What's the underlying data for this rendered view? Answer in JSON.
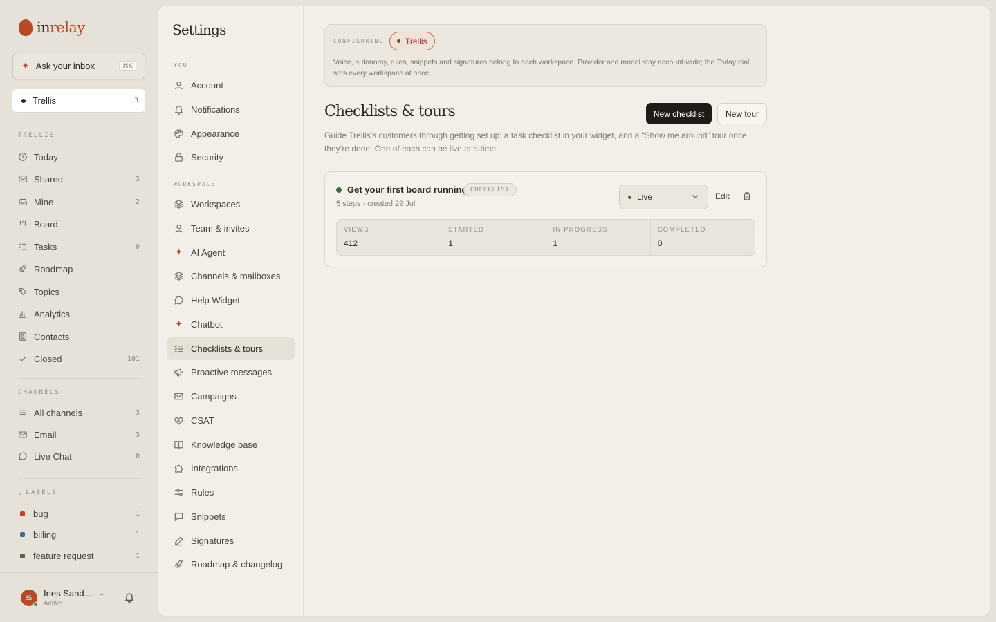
{
  "brand": {
    "name_prefix": "in",
    "name_suffix": "relay"
  },
  "ask": {
    "label": "Ask your inbox",
    "shortcut": "⌘K"
  },
  "workspace": {
    "name": "Trellis",
    "count": "3"
  },
  "sidebar": {
    "section_trellis": "TRELLIS",
    "items": [
      {
        "label": "Today",
        "count": "",
        "icon": "clock-icon"
      },
      {
        "label": "Shared",
        "count": "3",
        "icon": "inbox-icon"
      },
      {
        "label": "Mine",
        "count": "2",
        "icon": "inbox-tray-icon"
      },
      {
        "label": "Board",
        "count": "",
        "icon": "board-icon"
      },
      {
        "label": "Tasks",
        "count": "0",
        "icon": "tasks-icon"
      },
      {
        "label": "Roadmap",
        "count": "",
        "icon": "rocket-icon"
      },
      {
        "label": "Topics",
        "count": "",
        "icon": "tag-icon"
      },
      {
        "label": "Analytics",
        "count": "",
        "icon": "bar-chart-icon"
      },
      {
        "label": "Contacts",
        "count": "",
        "icon": "contact-card-icon"
      },
      {
        "label": "Closed",
        "count": "101",
        "icon": "check-icon"
      }
    ],
    "section_channels": "CHANNELS",
    "channels": [
      {
        "label": "All channels",
        "count": "3",
        "icon": "lines-icon"
      },
      {
        "label": "Email",
        "count": "3",
        "icon": "mail-icon"
      },
      {
        "label": "Live Chat",
        "count": "0",
        "icon": "chat-bubble-icon"
      }
    ],
    "section_labels": "LABELS",
    "labels": [
      {
        "label": "bug",
        "count": "1",
        "color": "#b54a2a"
      },
      {
        "label": "billing",
        "count": "1",
        "color": "#3e6a9a"
      },
      {
        "label": "feature request",
        "count": "1",
        "color": "#4d6b3e"
      }
    ]
  },
  "user": {
    "initials": "IS",
    "name": "Ines Sand...",
    "status": "Active"
  },
  "settings": {
    "title": "Settings",
    "section_you": "YOU",
    "you_items": [
      {
        "label": "Account",
        "icon": "user-icon"
      },
      {
        "label": "Notifications",
        "icon": "bell-icon"
      },
      {
        "label": "Appearance",
        "icon": "palette-icon"
      },
      {
        "label": "Security",
        "icon": "lock-icon"
      }
    ],
    "section_workspace": "WORKSPACE",
    "workspace_items": [
      {
        "label": "Workspaces",
        "icon": "layers-icon"
      },
      {
        "label": "Team & invites",
        "icon": "user-icon"
      },
      {
        "label": "AI Agent",
        "icon": "sparkle-icon"
      },
      {
        "label": "Channels & mailboxes",
        "icon": "layers-icon"
      },
      {
        "label": "Help Widget",
        "icon": "chat-bubble-icon"
      },
      {
        "label": "Chatbot",
        "icon": "sparkle-icon"
      },
      {
        "label": "Checklists & tours",
        "icon": "checklist-icon"
      },
      {
        "label": "Proactive messages",
        "icon": "megaphone-icon"
      },
      {
        "label": "Campaigns",
        "icon": "mail-icon"
      },
      {
        "label": "CSAT",
        "icon": "heart-hand-icon"
      },
      {
        "label": "Knowledge base",
        "icon": "book-icon"
      },
      {
        "label": "Integrations",
        "icon": "puzzle-icon"
      },
      {
        "label": "Rules",
        "icon": "sliders-icon"
      },
      {
        "label": "Snippets",
        "icon": "message-square-icon"
      },
      {
        "label": "Signatures",
        "icon": "pen-icon"
      },
      {
        "label": "Roadmap & changelog",
        "icon": "rocket-icon"
      }
    ],
    "active": "Checklists & tours"
  },
  "config": {
    "label": "CONFIGURING",
    "workspace": "Trellis",
    "description": "Voice, autonomy, rules, snippets and signatures belong to each workspace. Provider and model stay account-wide; the Today dial sets every workspace at once."
  },
  "page": {
    "title": "Checklists & tours",
    "new_checklist": "New checklist",
    "new_tour": "New tour",
    "description": "Guide Trellis’s customers through getting set up: a task checklist in your widget, and a “Show me around” tour once they’re done. One of each can be live at a time."
  },
  "checklist": {
    "title": "Get your first board running",
    "badge": "CHECKLIST",
    "meta": "5 steps · created 29 Jul",
    "status": "Live",
    "edit": "Edit",
    "stats": [
      {
        "label": "VIEWS",
        "value": "412"
      },
      {
        "label": "STARTED",
        "value": "1"
      },
      {
        "label": "IN PROGRESS",
        "value": "1"
      },
      {
        "label": "COMPLETED",
        "value": "0"
      }
    ]
  },
  "colors": {
    "accent": "#b54a2a",
    "live": "#3f6b3a",
    "background": "#e7e2d9",
    "panel": "#f2efe8"
  }
}
